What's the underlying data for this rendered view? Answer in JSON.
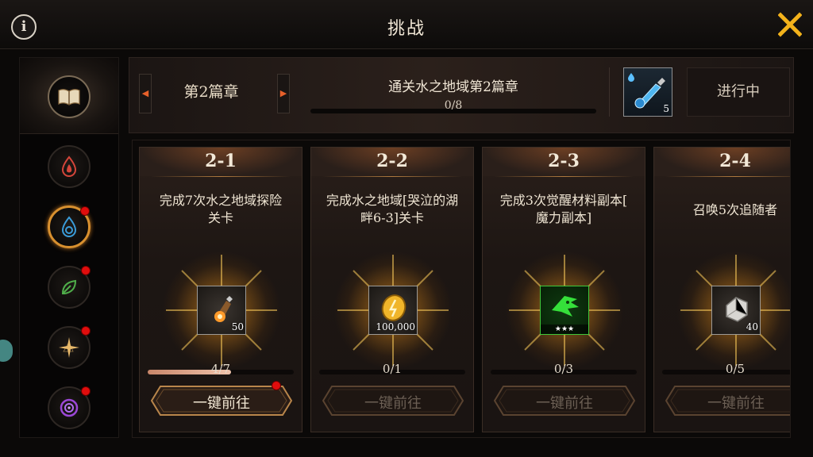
{
  "header": {
    "title": "挑战",
    "info_icon": "info-icon",
    "close_icon": "close-icon",
    "close_color": "#f3b21b"
  },
  "sidebar": {
    "items": [
      {
        "name": "book",
        "icon": "book-icon",
        "active": false,
        "badge": false
      },
      {
        "name": "fire",
        "icon": "fire-drop-icon",
        "color": "#d4453a",
        "active": false,
        "badge": false
      },
      {
        "name": "water",
        "icon": "water-drop-icon",
        "color": "#3a9bd8",
        "active": true,
        "badge": true
      },
      {
        "name": "leaf",
        "icon": "leaf-icon",
        "color": "#4fae4a",
        "active": false,
        "badge": true
      },
      {
        "name": "light",
        "icon": "star-burst-icon",
        "color": "#e8b96a",
        "active": false,
        "badge": true
      },
      {
        "name": "dark",
        "icon": "swirl-icon",
        "color": "#9b47d6",
        "active": false,
        "badge": true
      }
    ]
  },
  "chapter": {
    "name": "第2篇章",
    "goal": "通关水之地域第2篇章",
    "goal_progress": "0/8",
    "reward_qty": "5",
    "reward_icon": "mana-potion-icon",
    "status": "进行中"
  },
  "cards": [
    {
      "id": "2-1",
      "desc": "完成7次水之地域探险关卡",
      "desc_lines": [
        "完成7次水之地域探险",
        "关卡"
      ],
      "item_icon": "lantern-icon",
      "item_qty": "50",
      "progress": "4/7",
      "progress_fraction": 0.57,
      "button": "一键前往",
      "button_enabled": true,
      "badge": true
    },
    {
      "id": "2-2",
      "desc": "完成水之地域[哭泣的湖畔6-3]关卡",
      "desc_lines": [
        "完成水之地域[哭泣的湖",
        "畔6-3]关卡"
      ],
      "item_icon": "gold-coin-icon",
      "item_qty": "100,000",
      "progress": "0/1",
      "progress_fraction": 0,
      "button": "一键前往",
      "button_enabled": false,
      "badge": false
    },
    {
      "id": "2-3",
      "desc": "完成3次觉醒材料副本[魔力副本]",
      "desc_lines": [
        "完成3次觉醒材料副本[",
        "魔力副本]"
      ],
      "item_icon": "green-rune-icon",
      "item_stars": "★★★",
      "progress": "0/3",
      "progress_fraction": 0,
      "button": "一键前往",
      "button_enabled": false,
      "badge": false
    },
    {
      "id": "2-4",
      "desc": "召唤5次追随者",
      "desc_lines": [
        "召唤5次追随者"
      ],
      "item_icon": "silver-ore-icon",
      "item_qty": "40",
      "progress": "0/5",
      "progress_fraction": 0,
      "button": "一键前往",
      "button_enabled": false,
      "badge": false
    }
  ]
}
